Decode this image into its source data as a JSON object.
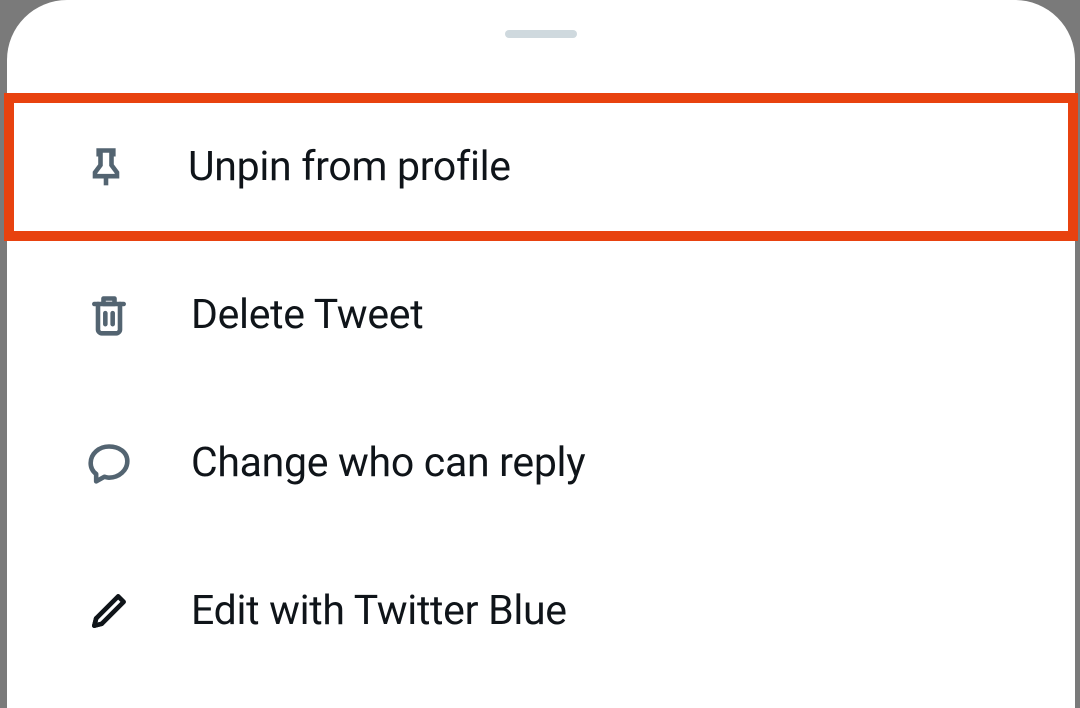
{
  "menu": {
    "items": [
      {
        "icon": "pin-icon",
        "label": "Unpin from profile",
        "highlighted": true
      },
      {
        "icon": "trash-icon",
        "label": "Delete Tweet",
        "highlighted": false
      },
      {
        "icon": "speech-bubble-icon",
        "label": "Change who can reply",
        "highlighted": false
      },
      {
        "icon": "pencil-icon",
        "label": "Edit with Twitter Blue",
        "highlighted": false
      }
    ]
  }
}
